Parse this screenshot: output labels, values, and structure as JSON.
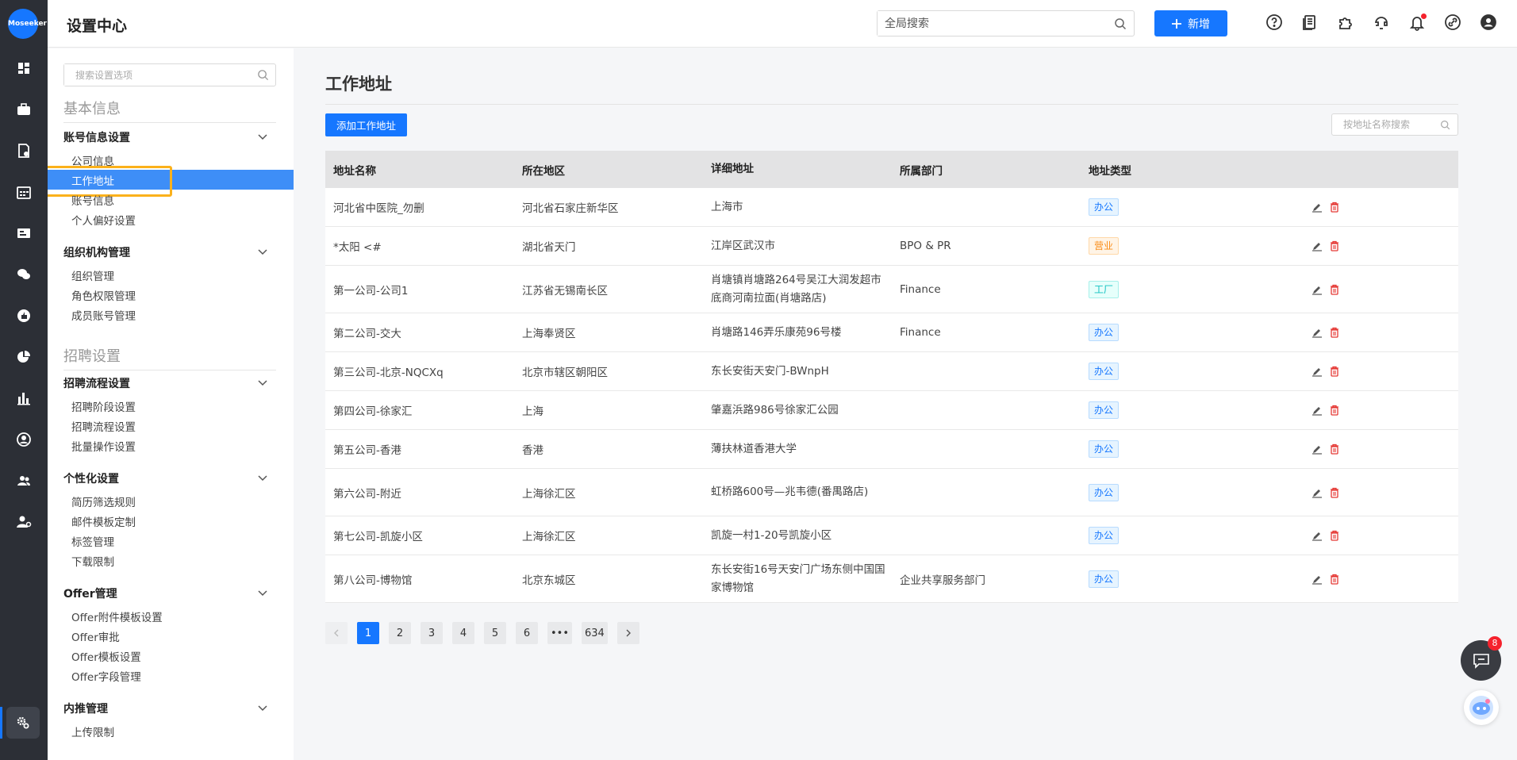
{
  "app": {
    "logo_text": "Moseeker"
  },
  "header": {
    "title": "设置中心",
    "search_placeholder": "全局搜索",
    "new_label": "新增"
  },
  "sidebar": {
    "search_placeholder": "搜索设置选项",
    "sections": [
      {
        "title": "基本信息"
      },
      {
        "title": "招聘设置"
      }
    ],
    "groups": {
      "account": {
        "title": "账号信息设置",
        "items": [
          "公司信息",
          "工作地址",
          "账号信息",
          "个人偏好设置"
        ]
      },
      "org": {
        "title": "组织机构管理",
        "items": [
          "组织管理",
          "角色权限管理",
          "成员账号管理"
        ]
      },
      "flow": {
        "title": "招聘流程设置",
        "items": [
          "招聘阶段设置",
          "招聘流程设置",
          "批量操作设置"
        ]
      },
      "personal": {
        "title": "个性化设置",
        "items": [
          "简历筛选规则",
          "邮件模板定制",
          "标签管理",
          "下载限制"
        ]
      },
      "offer": {
        "title": "Offer管理",
        "items": [
          "Offer附件模板设置",
          "Offer审批",
          "Offer模板设置",
          "Offer字段管理"
        ]
      },
      "referral": {
        "title": "内推管理",
        "items": [
          "上传限制"
        ]
      }
    }
  },
  "main": {
    "heading": "工作地址",
    "add_button": "添加工作地址",
    "search_placeholder": "按地址名称搜索",
    "columns": [
      "地址名称",
      "所在地区",
      "详细地址",
      "所属部门",
      "地址类型"
    ],
    "rows": [
      {
        "name": "河北省中医院_勿删",
        "region": "河北省石家庄新华区",
        "address": "上海市",
        "dept": "",
        "type": "办公"
      },
      {
        "name": "*太阳 <#",
        "region": "湖北省天门",
        "address": "江岸区武汉市",
        "dept": "BPO & PR",
        "type": "营业"
      },
      {
        "name": "第一公司-公司1",
        "region": "江苏省无锡南长区",
        "address": "肖塘镇肖塘路264号吴江大润发超市底商河南拉面(肖塘路店)",
        "dept": "Finance",
        "type": "工厂"
      },
      {
        "name": "第二公司-交大",
        "region": "上海奉贤区",
        "address": "肖塘路146弄乐康苑96号楼",
        "dept": "Finance",
        "type": "办公"
      },
      {
        "name": "第三公司-北京-NQCXq",
        "region": "北京市辖区朝阳区",
        "address": "东长安街天安门-BWnpH",
        "dept": "",
        "type": "办公"
      },
      {
        "name": "第四公司-徐家汇",
        "region": "上海",
        "address": "肇嘉浜路986号徐家汇公园",
        "dept": "",
        "type": "办公"
      },
      {
        "name": "第五公司-香港",
        "region": "香港",
        "address": "薄扶林道香港大学",
        "dept": "",
        "type": "办公"
      },
      {
        "name": "第六公司-附近",
        "region": "上海徐汇区",
        "address": "虹桥路600号—兆韦德(番禺路店)",
        "dept": "",
        "type": "办公"
      },
      {
        "name": "第七公司-凯旋小区",
        "region": "上海徐汇区",
        "address": "凯旋一村1-20号凯旋小区",
        "dept": "",
        "type": "办公"
      },
      {
        "name": "第八公司-博物馆",
        "region": "北京东城区",
        "address": "东长安街16号天安门广场东侧中国国家博物馆",
        "dept": "企业共享服务部门",
        "type": "办公"
      }
    ],
    "pagination": {
      "current": "1",
      "pages": [
        "1",
        "2",
        "3",
        "4",
        "5",
        "6"
      ],
      "ellipsis": "•••",
      "last": "634"
    }
  },
  "chat": {
    "badge": "8"
  },
  "colors": {
    "primary": "#1677ff",
    "rail": "#2c2f36",
    "highlight": "#fbb11b"
  }
}
